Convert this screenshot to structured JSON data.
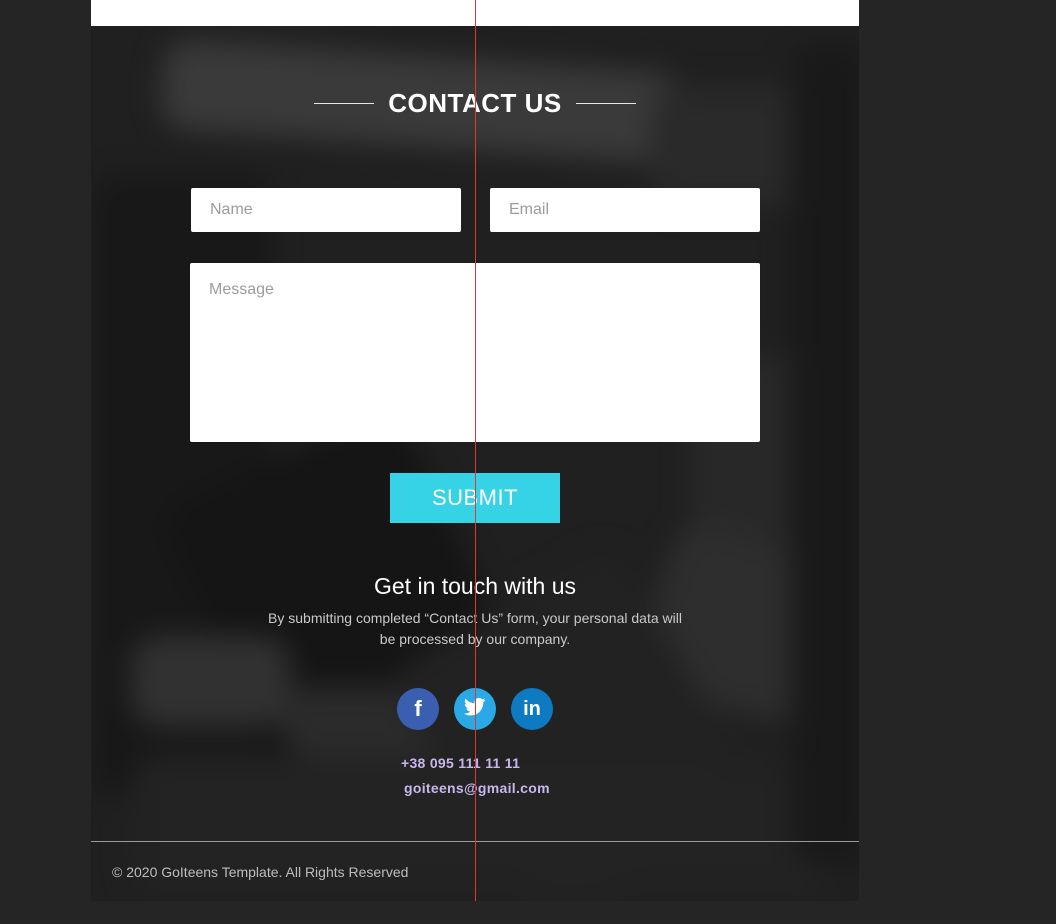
{
  "contact": {
    "heading": "CONTACT US",
    "name_placeholder": "Name",
    "email_placeholder": "Email",
    "message_placeholder": "Message",
    "submit_label": "SUBMIT"
  },
  "info": {
    "title": "Get in touch with us",
    "description": "By submitting completed “Contact Us” form, your personal data will be processed by our company."
  },
  "social": [
    {
      "name": "facebook",
      "icon": "facebook-icon",
      "color": "#3a5fb0",
      "glyph": "f"
    },
    {
      "name": "twitter",
      "icon": "twitter-icon",
      "color": "#2aa9e6"
    },
    {
      "name": "linkedin",
      "icon": "linkedin-icon",
      "color": "#0e7ac2",
      "glyph": "in"
    }
  ],
  "phone": "+38 095 111 11 11",
  "email": "goiteens@gmail.com",
  "footer": {
    "copyright": "© 2020 GoIteens Template. All Rights Reserved"
  },
  "colors": {
    "accent": "#36d2e6",
    "link": "#c8b6ee",
    "page_background": "#252525"
  }
}
